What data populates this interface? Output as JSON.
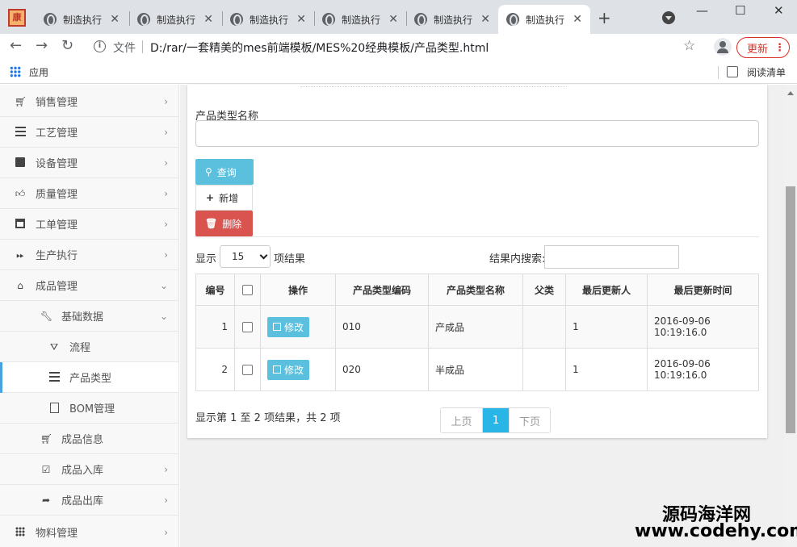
{
  "browser": {
    "app_icon_text": "康",
    "tabs": [
      {
        "title": "制造执行"
      },
      {
        "title": "制造执行"
      },
      {
        "title": "制造执行"
      },
      {
        "title": "制造执行"
      },
      {
        "title": "制造执行"
      },
      {
        "title": "制造执行"
      }
    ],
    "active_tab_index": 5,
    "new_tab": "+",
    "close_glyph": "✕",
    "url_label": "文件",
    "url": "D:/rar/一套精美的mes前端模板/MES%20经典模板/产品类型.html",
    "update_label": "更新",
    "update_more": "⋮",
    "bookmarks_apps": "应用",
    "reading_list": "阅读清单",
    "window_controls": {
      "minimize": "—",
      "maximize": "☐",
      "close": "✕"
    }
  },
  "sidebar": {
    "items": [
      {
        "label": "销售管理",
        "icon": "cart-icon",
        "chevron": "›"
      },
      {
        "label": "工艺管理",
        "icon": "list-icon",
        "chevron": "›"
      },
      {
        "label": "设备管理",
        "icon": "inbox-icon",
        "chevron": "›"
      },
      {
        "label": "质量管理",
        "icon": "thumbs-up-icon",
        "chevron": "›"
      },
      {
        "label": "工单管理",
        "icon": "calendar-icon",
        "chevron": "›"
      },
      {
        "label": "生产执行",
        "icon": "fast-forward-icon",
        "chevron": "›"
      },
      {
        "label": "成品管理",
        "icon": "home-icon",
        "chevron": "⌄"
      },
      {
        "label": "基础数据",
        "icon": "wrench-icon",
        "chevron": "⌄"
      },
      {
        "label": "流程",
        "icon": "road-icon"
      },
      {
        "label": "产品类型",
        "icon": "server-icon"
      },
      {
        "label": "BOM管理",
        "icon": "document-icon"
      },
      {
        "label": "成品信息",
        "icon": "cart-icon"
      },
      {
        "label": "成品入库",
        "icon": "check-square-icon",
        "chevron": "›"
      },
      {
        "label": "成品出库",
        "icon": "share-arrow-icon",
        "chevron": "›"
      },
      {
        "label": "物料管理",
        "icon": "grid-icon",
        "chevron": "›"
      }
    ]
  },
  "form": {
    "name_label": "产品类型名称",
    "name_value": "",
    "query_button": "查询",
    "add_button": "新增",
    "delete_button": "删除"
  },
  "table_controls": {
    "show_label": "显示",
    "page_size": "15",
    "result_label": "项结果",
    "search_label": "结果内搜索:",
    "search_value": ""
  },
  "table": {
    "columns": [
      "编号",
      "",
      "操作",
      "产品类型编码",
      "产品类型名称",
      "父类",
      "最后更新人",
      "最后更新时间"
    ],
    "rows": [
      {
        "id": "1",
        "action": "修改",
        "code": "010",
        "name": "产成品",
        "parent": "",
        "updater": "1",
        "time_date": "2016-09-06",
        "time_clock": "10:19:16.0"
      },
      {
        "id": "2",
        "action": "修改",
        "code": "020",
        "name": "半成品",
        "parent": "",
        "updater": "1",
        "time_date": "2016-09-06",
        "time_clock": "10:19:16.0"
      }
    ]
  },
  "pagination": {
    "info": "显示第 1 至 2 项结果，共 2 项",
    "prev": "上页",
    "current": "1",
    "next": "下页"
  },
  "watermark": {
    "line1": "源码海洋网",
    "line2": "www.codehy.com"
  },
  "colors": {
    "info": "#5bc0de",
    "danger": "#d9534f",
    "page_active": "#29b6e6",
    "sidebar_active_bar": "#4aa3df"
  }
}
